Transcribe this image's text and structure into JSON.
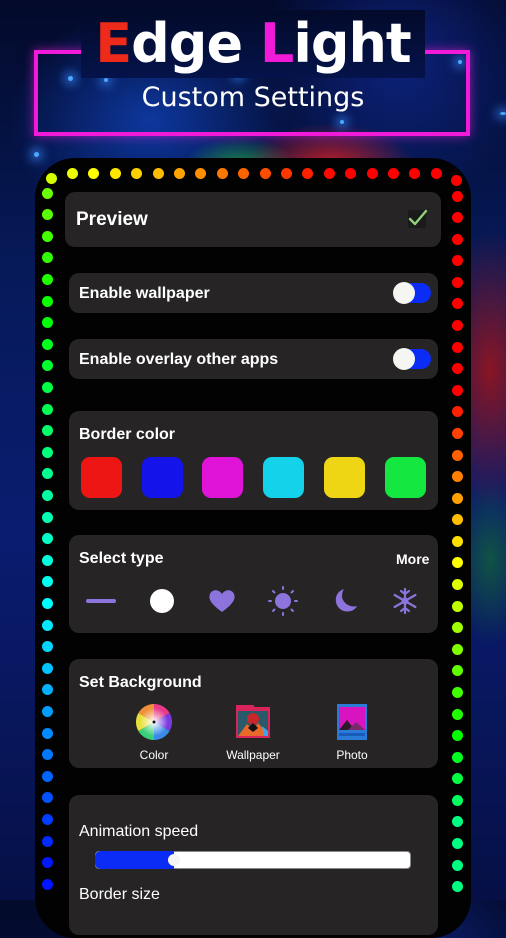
{
  "header": {
    "title_first_letter": "E",
    "title_rest_1": "dge ",
    "title_second_letter": "L",
    "title_rest_2": "ight",
    "subtitle": "Custom Settings",
    "accent_e": "#ee2a1a",
    "accent_l": "#f01ad8",
    "frame_color": "#f01ad8"
  },
  "preview": {
    "label": "Preview",
    "checked": true,
    "check_icon": "check-icon"
  },
  "toggles": [
    {
      "label": "Enable wallpaper",
      "track_color": "#0a2cf5"
    },
    {
      "label": "Enable overlay other apps",
      "track_color": "#0a2cf5"
    }
  ],
  "border_color": {
    "label": "Border color",
    "swatches": [
      "#ee1515",
      "#1414ea",
      "#e014d8",
      "#14d2ea",
      "#eed614",
      "#14e840"
    ]
  },
  "select_type": {
    "label": "Select type",
    "more_label": "More",
    "icon_color": "#8c74dc",
    "types": [
      {
        "icon": "line-icon"
      },
      {
        "icon": "circle-icon",
        "selected": true
      },
      {
        "icon": "heart-icon"
      },
      {
        "icon": "sun-icon"
      },
      {
        "icon": "moon-icon"
      },
      {
        "icon": "snowflake-icon"
      }
    ]
  },
  "background": {
    "label": "Set Background",
    "options": [
      {
        "label": "Color",
        "icon": "color-wheel-icon"
      },
      {
        "label": "Wallpaper",
        "icon": "wallpaper-icon"
      },
      {
        "label": "Photo",
        "icon": "photo-icon"
      }
    ]
  },
  "animation": {
    "speed_label": "Animation speed",
    "speed_value_fraction": 0.25,
    "border_size_label": "Border size"
  }
}
